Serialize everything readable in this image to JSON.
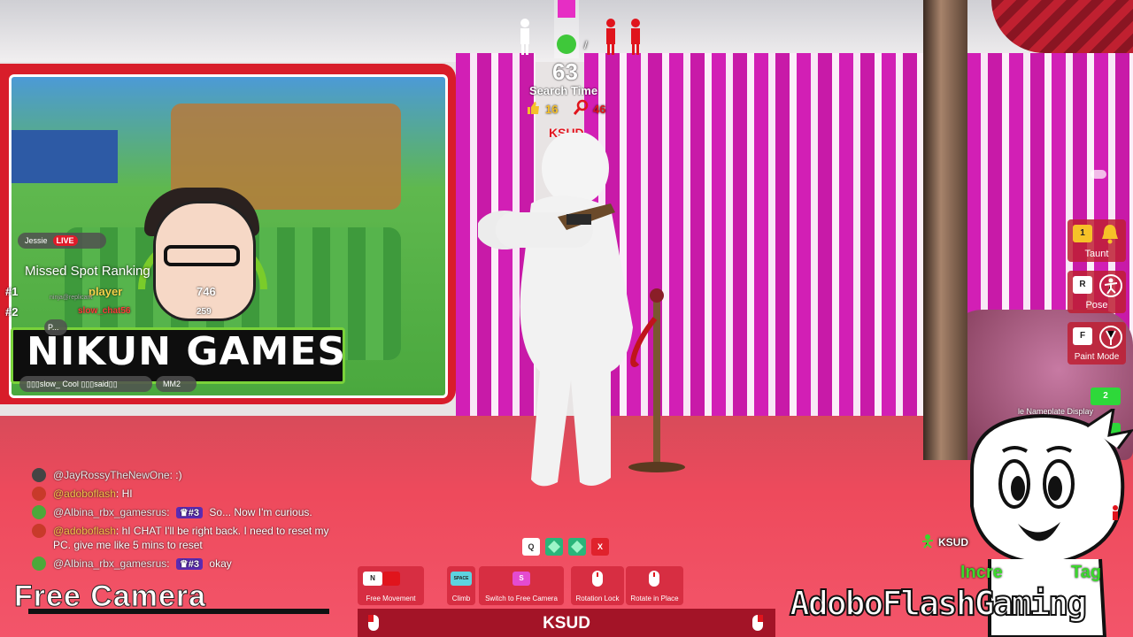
{
  "hud": {
    "timer": "63",
    "search_time_label": "Search Time",
    "likes": "16",
    "finds": "46",
    "target_name": "KSUD"
  },
  "billboard": {
    "banner_text": "NIKUN GAMES",
    "live_user": "Jessie",
    "live_label": "LIVE",
    "bubble_2": "P...",
    "bottom_bubble": "▯▯▯slow_ Cool ▯▯▯said▯▯",
    "bottom_badge": "MM2"
  },
  "ranking": {
    "title": "Missed Spot Ranking",
    "rows": [
      {
        "rank": "#1",
        "name": "player",
        "sub": "ninja@replicant",
        "score": "746"
      },
      {
        "rank": "#2",
        "name": "slow_chat56",
        "score": "259"
      }
    ]
  },
  "chat": [
    {
      "user": "@JayRossyTheNewOne",
      "user_color": "#e8e8e8",
      "badge": "",
      "message": ":)"
    },
    {
      "user": "@adoboflash",
      "user_color": "#f0c24a",
      "badge": "",
      "message": "HI"
    },
    {
      "user": "@Albina_rbx_gamesrus",
      "user_color": "#e8e8e8",
      "badge": "#3",
      "message": "So... Now I'm curious."
    },
    {
      "user": "@adoboflash",
      "user_color": "#f0c24a",
      "badge": "",
      "message": "hI CHAT I'll be right back. I need to reset my PC. give me like 5 mins to reset"
    },
    {
      "user": "@Albina_rbx_gamesrus",
      "user_color": "#e8e8e8",
      "badge": "#3",
      "message": "okay"
    }
  ],
  "free_camera_label": "Free Camera",
  "action_bar": [
    "Q",
    "",
    "",
    "X"
  ],
  "controls": [
    {
      "key": "N",
      "label": "Free Movement"
    },
    {
      "key": "SPACE",
      "label": "Climb"
    },
    {
      "key": "S",
      "label": "Switch to Free Camera"
    },
    {
      "key": "",
      "label": "Rotation Lock"
    },
    {
      "key": "",
      "label": "Rotate in Place"
    }
  ],
  "spectate_name": "KSUD",
  "side_actions": [
    {
      "key": "1",
      "label": "Taunt"
    },
    {
      "key": "R",
      "label": "Pose"
    },
    {
      "key": "F",
      "label": "Paint Mode"
    }
  ],
  "nameplate": {
    "key": "2",
    "label": "le Nameplate Display"
  },
  "player_tag": "KSUD",
  "overlay": {
    "brand": "AdoboFlashGaming",
    "incr": "Incre",
    "tag": "Tag"
  },
  "colors": {
    "accent_red": "#d81d2a",
    "stripe_pink": "#d21fb5",
    "highlight_green": "#3bd82c",
    "badge_purple": "#5b2bb3"
  }
}
